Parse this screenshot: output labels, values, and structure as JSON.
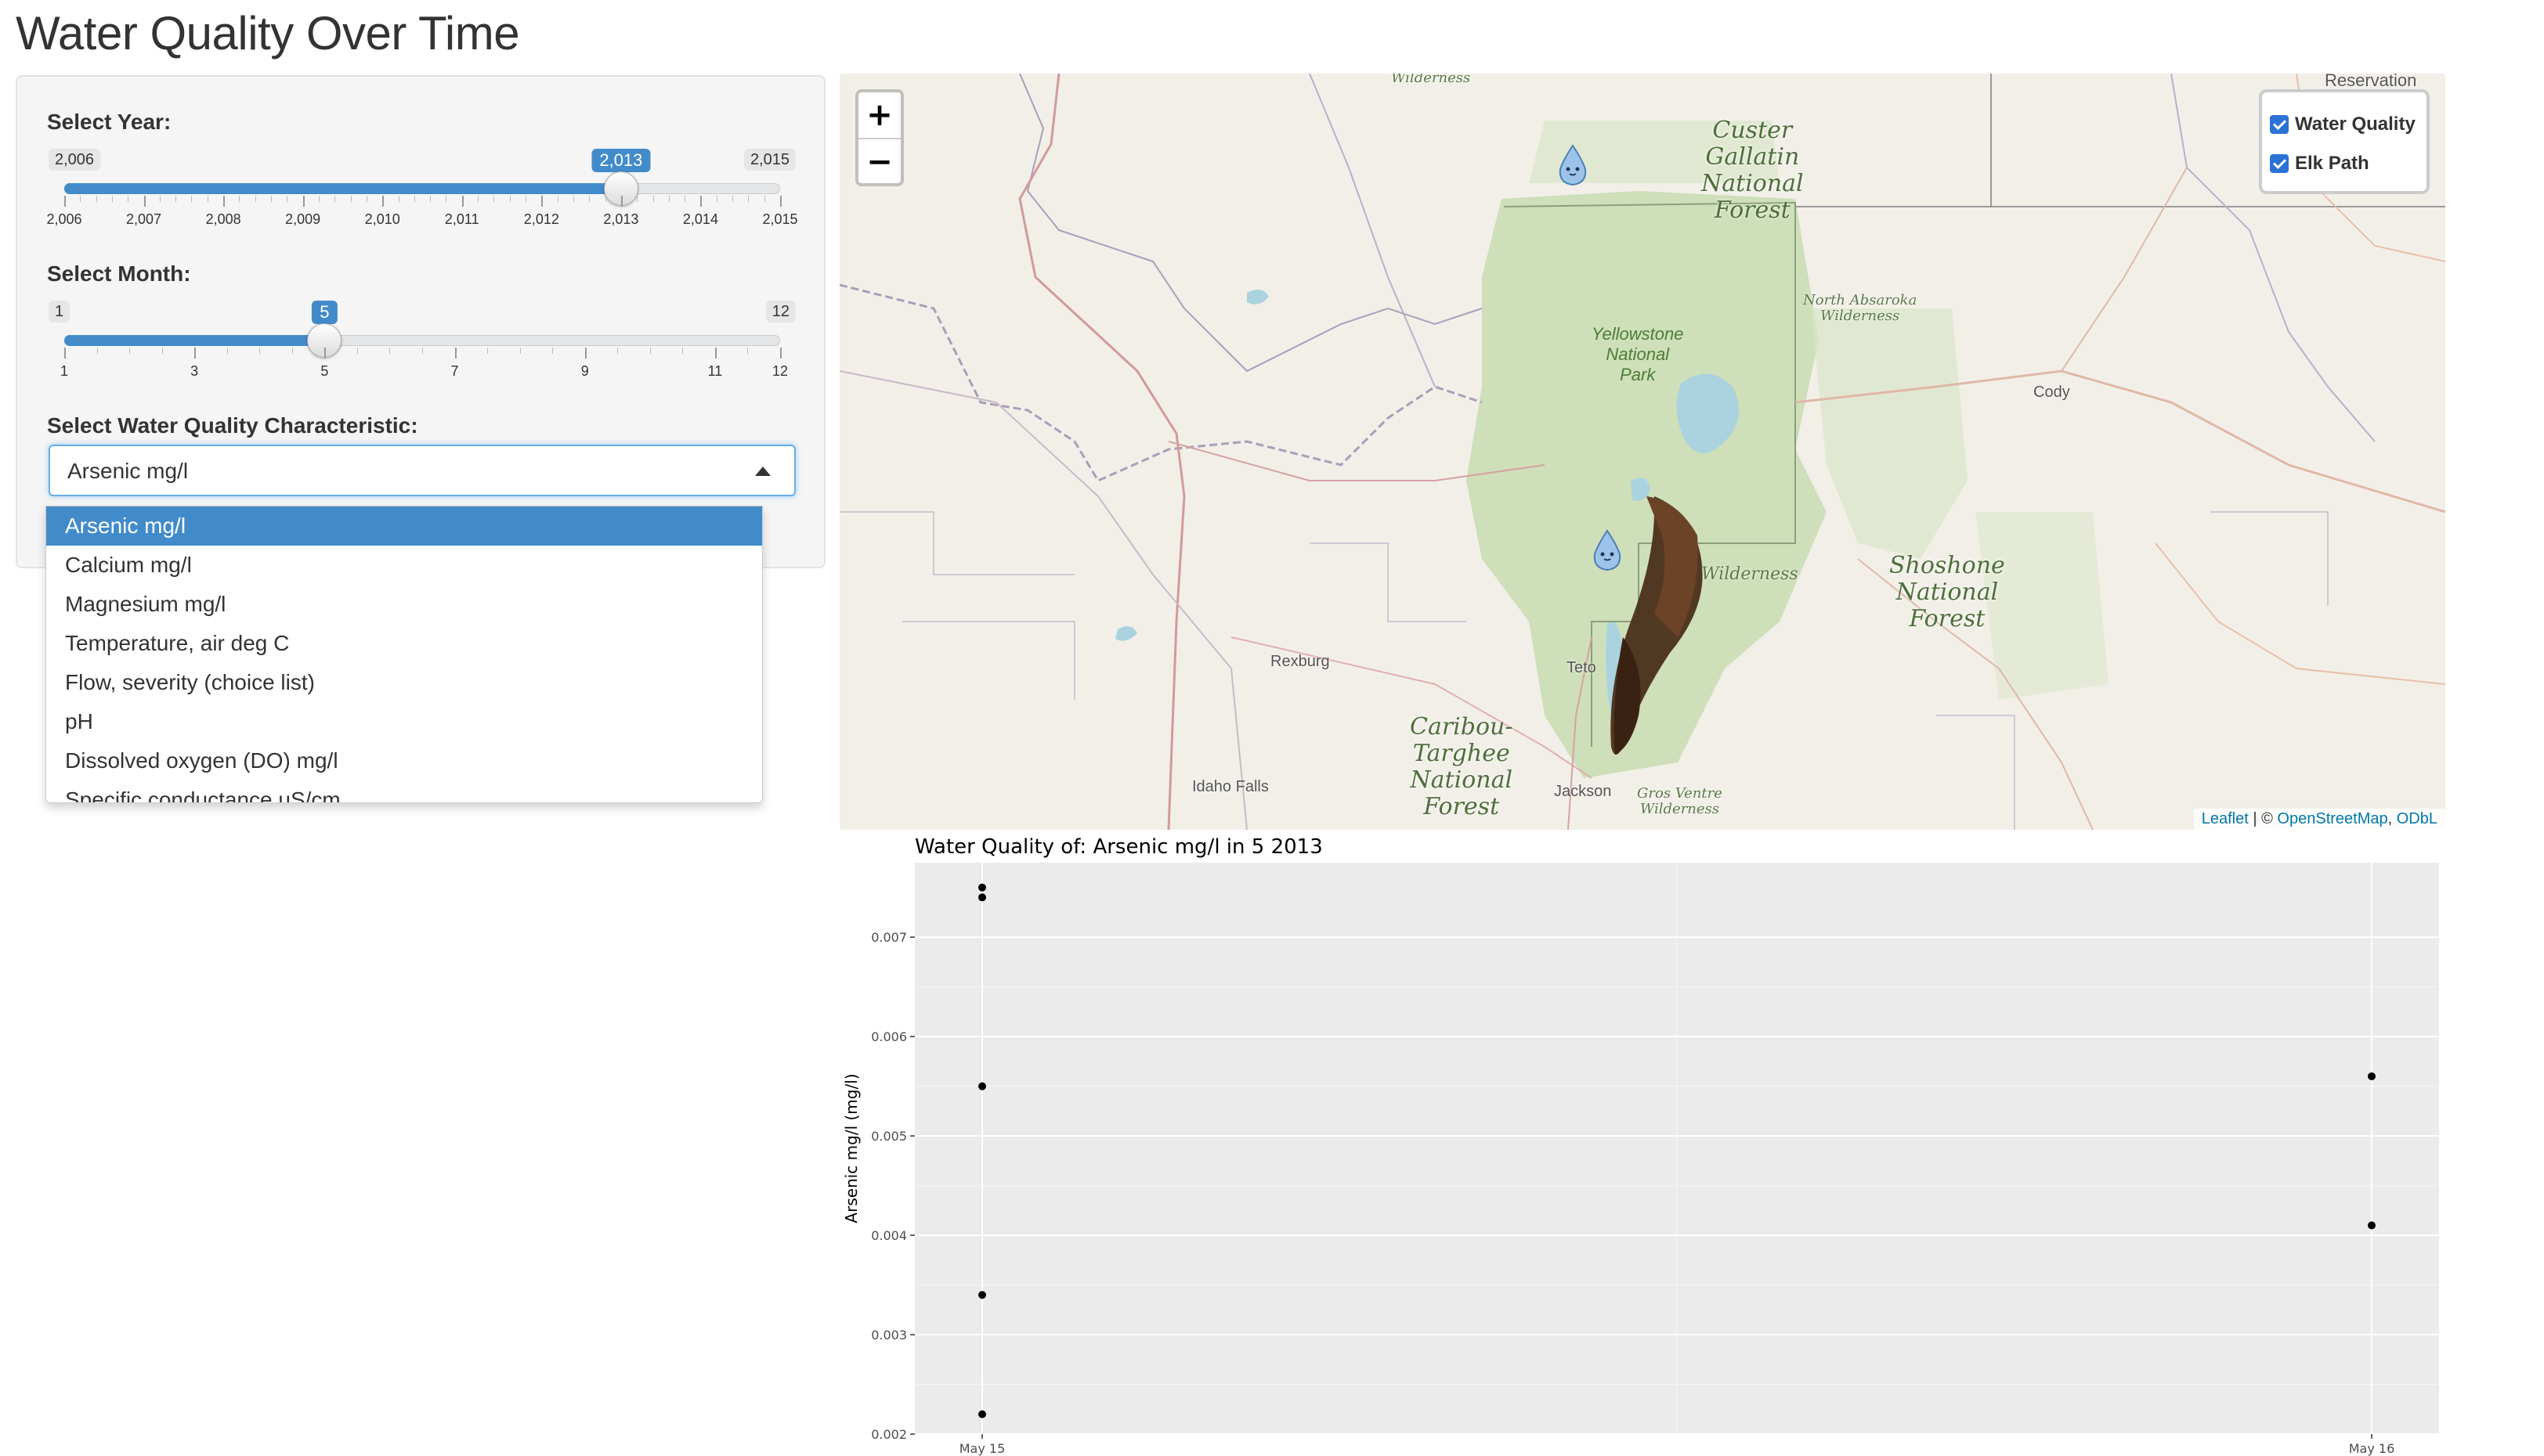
{
  "app": {
    "title": "Water Quality Over Time"
  },
  "year_slider": {
    "label": "Select Year:",
    "min_label": "2,006",
    "max_label": "2,015",
    "value_label": "2,013",
    "min": 2006,
    "max": 2015,
    "value": 2013,
    "tick_labels": [
      "2,006",
      "2,007",
      "2,008",
      "2,009",
      "2,010",
      "2,011",
      "2,012",
      "2,013",
      "2,014",
      "2,015"
    ]
  },
  "month_slider": {
    "label": "Select Month:",
    "min_label": "1",
    "max_label": "12",
    "value_label": "5",
    "min": 1,
    "max": 12,
    "value": 5,
    "tick_labels": [
      "1",
      "3",
      "5",
      "7",
      "9",
      "11",
      "12"
    ]
  },
  "characteristic": {
    "label": "Select Water Quality Characteristic:",
    "selected": "Arsenic mg/l",
    "options": [
      "Arsenic mg/l",
      "Calcium mg/l",
      "Magnesium mg/l",
      "Temperature, air deg C",
      "Flow, severity (choice list)",
      "pH",
      "Dissolved oxygen (DO) mg/l",
      "Specific conductance uS/cm"
    ]
  },
  "map": {
    "zoom_in": "+",
    "zoom_out": "−",
    "layers": [
      "Water Quality",
      "Elk Path"
    ],
    "attribution": {
      "leaflet": "Leaflet",
      "sep": " | © ",
      "osm": "OpenStreetMap",
      "comma": ", ",
      "odbl": "ODbL"
    },
    "places": {
      "cody": "Cody",
      "rexburg": "Rexburg",
      "idaho_falls": "Idaho Falls",
      "jackson": "Jackson",
      "teton": "Teto",
      "wilderness_top": "Wilderness",
      "reservation": "Reservation",
      "wilderness_mid": "Wilderness"
    },
    "forests": {
      "custer": "Custer\nGallatin\nNational\nForest",
      "shoshone": "Shoshone\nNational\nForest",
      "caribou": "Caribou-\nTarghee\nNational\nForest"
    },
    "wilderness_labels": {
      "north_absaroka": "North Absaroka\nWilderness",
      "gros_ventre": "Gros Ventre\nWilderness"
    },
    "park": "Yellowstone\nNational\nPark",
    "colors": {
      "land": "#f2efe9",
      "park_green": "#c8dcb0",
      "water": "#aad3df",
      "road": "#d6a2a2",
      "boundary": "#a89fb8"
    }
  },
  "chart_data": {
    "type": "scatter",
    "title": "Water Quality of: Arsenic mg/l in 5 2013",
    "xlabel": "",
    "ylabel": "Arsenic mg/l (mg/l)",
    "x_categories": [
      "May 15",
      "May 16"
    ],
    "y_ticks": [
      "0.002",
      "0.003",
      "0.004",
      "0.005",
      "0.006",
      "0.007"
    ],
    "ylim": [
      0.002,
      0.00775
    ],
    "points": [
      {
        "x": "May 15",
        "y": 0.0075
      },
      {
        "x": "May 15",
        "y": 0.0074
      },
      {
        "x": "May 15",
        "y": 0.0055
      },
      {
        "x": "May 15",
        "y": 0.0034
      },
      {
        "x": "May 15",
        "y": 0.0022
      },
      {
        "x": "May 16",
        "y": 0.0056
      },
      {
        "x": "May 16",
        "y": 0.0041
      }
    ],
    "grid": true,
    "panel_color": "#ebebeb"
  }
}
